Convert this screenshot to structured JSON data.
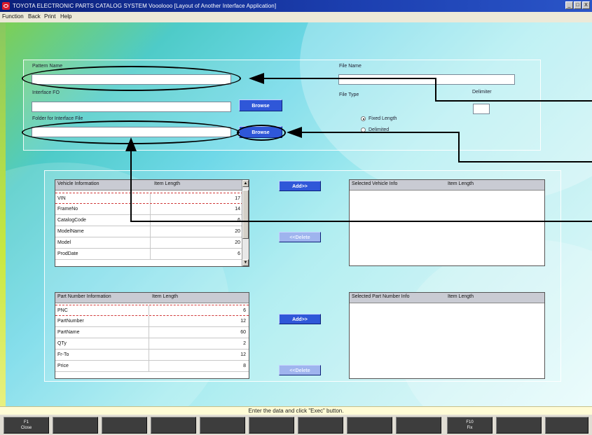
{
  "window": {
    "title": "TOYOTA ELECTRONIC PARTS CATALOG SYSTEM Vooolooo [Layout of Another Interface Application]",
    "controls": [
      "_",
      "□",
      "X"
    ]
  },
  "menu": [
    "Function",
    "Back",
    "Print",
    "Help"
  ],
  "form": {
    "pattern_name_label": "Pattern Name",
    "pattern_name_value": "",
    "interface_fo_label": "Interface FO",
    "interface_fo_value": "",
    "browse1_label": "Browse",
    "folder_label": "Folder for Interface File",
    "folder_value": "",
    "browse2_label": "Browse",
    "file_name_label": "File Name",
    "file_name_value": "",
    "file_type_label": "File Type",
    "delimiter_label": "Delimiter",
    "delimiter_value": "",
    "radio_fixed_label": "Fixed Length",
    "radio_fixed_selected": true,
    "radio_delimited_label": "Delimited",
    "radio_delimited_selected": false
  },
  "vehicle_table": {
    "headers": [
      "Vehicle Information",
      "Item Length"
    ],
    "rows": [
      {
        "name": "VIN",
        "len": "17"
      },
      {
        "name": "FrameNo",
        "len": "14"
      },
      {
        "name": "CatalogCode",
        "len": "6"
      },
      {
        "name": "ModelName",
        "len": "20"
      },
      {
        "name": "Model",
        "len": "20"
      },
      {
        "name": "ProdDate",
        "len": "6"
      }
    ]
  },
  "selected_vehicle_table": {
    "headers": [
      "Selected Vehicle Info",
      "Item Length"
    ]
  },
  "parts_table": {
    "headers": [
      "Part Number Information",
      "Item Length"
    ],
    "rows": [
      {
        "name": "PNC",
        "len": "6"
      },
      {
        "name": "PartNumber",
        "len": "12"
      },
      {
        "name": "PartName",
        "len": "60"
      },
      {
        "name": "QTy",
        "len": "2"
      },
      {
        "name": "Fr-To",
        "len": "12"
      },
      {
        "name": "Price",
        "len": "8"
      }
    ]
  },
  "selected_parts_table": {
    "headers": [
      "Selected Part Number Info",
      "Item Length"
    ]
  },
  "buttons": {
    "add1": "Add>>",
    "delete1": "<<Delete",
    "add2": "Add>>",
    "delete2": "<<Delete"
  },
  "status": "Enter the data and click \"Exec\" button.",
  "fkeys": [
    {
      "key": "F1",
      "label": "Close"
    },
    {
      "key": "",
      "label": ""
    },
    {
      "key": "",
      "label": ""
    },
    {
      "key": "",
      "label": ""
    },
    {
      "key": "",
      "label": ""
    },
    {
      "key": "",
      "label": ""
    },
    {
      "key": "",
      "label": ""
    },
    {
      "key": "",
      "label": ""
    },
    {
      "key": "",
      "label": ""
    },
    {
      "key": "F10",
      "label": "Fix"
    },
    {
      "key": "",
      "label": ""
    },
    {
      "key": "",
      "label": ""
    }
  ],
  "colors": {
    "title_bar": "#1c3fb0",
    "button_blue": "#2f57d8",
    "status_bg": "#fffcd6"
  }
}
